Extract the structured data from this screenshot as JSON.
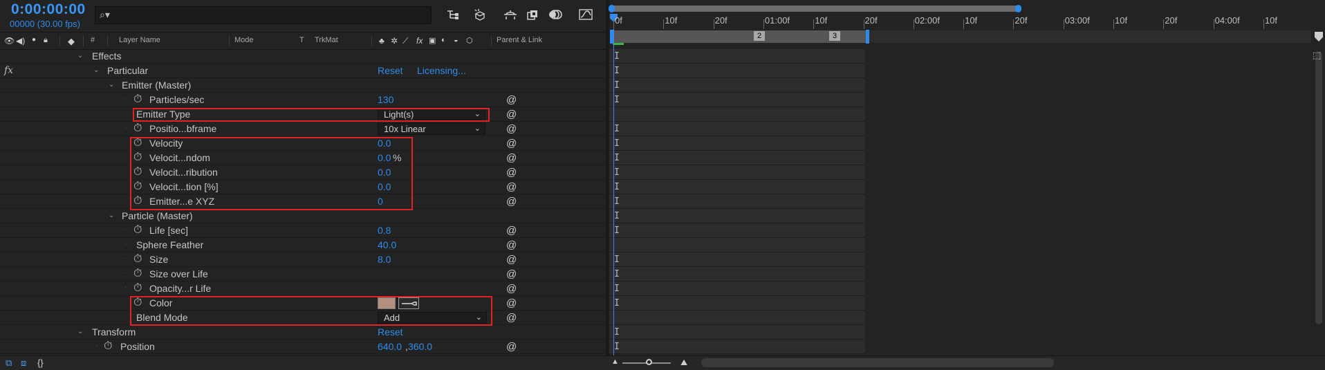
{
  "header": {
    "timecode": "0:00:00:00",
    "fps_line": "00000 (30.00 fps)",
    "search_icon": "search-icon"
  },
  "columns": {
    "label": "#",
    "layer_name": "Layer Name",
    "mode": "Mode",
    "t": "T",
    "trkmat": "TrkMat",
    "parent_link": "Parent & Link"
  },
  "rows": {
    "effects": "Effects",
    "fx": "fx",
    "particular": "Particular",
    "reset": "Reset",
    "licensing": "Licensing...",
    "emitter_master": "Emitter (Master)",
    "particles_sec": {
      "label": "Particles/sec",
      "value": "130"
    },
    "emitter_type": {
      "label": "Emitter Type",
      "value": "Light(s)"
    },
    "position_subframe": {
      "label": "Positio...bframe",
      "value": "10x Linear"
    },
    "velocity": {
      "label": "Velocity",
      "value": "0.0"
    },
    "velocity_random": {
      "label": "Velocit...ndom",
      "value": "0.0",
      "unit": "%"
    },
    "velocity_distribution": {
      "label": "Velocit...ribution",
      "value": "0.0"
    },
    "velocity_motion": {
      "label": "Velocit...tion [%]",
      "value": "0.0"
    },
    "emitter_size": {
      "label": "Emitter...e XYZ",
      "value": "0"
    },
    "particle_master": "Particle (Master)",
    "life": {
      "label": "Life [sec]",
      "value": "0.8"
    },
    "sphere_feather": {
      "label": "Sphere Feather",
      "value": "40.0"
    },
    "size": {
      "label": "Size",
      "value": "8.0"
    },
    "size_over_life": {
      "label": "Size over Life"
    },
    "opacity_over_life": {
      "label": "Opacity...r Life"
    },
    "color": {
      "label": "Color",
      "swatch": "#b48f7d"
    },
    "blend_mode": {
      "label": "Blend Mode",
      "value": "Add"
    },
    "transform": "Transform",
    "transform_reset": "Reset",
    "position": {
      "label": "Position",
      "value_x": "640.0",
      "sep": ",",
      "value_y": "360.0"
    }
  },
  "timeline": {
    "ruler_labels": [
      "0f",
      "10f",
      "20f",
      "01:00f",
      "10f",
      "20f",
      "02:00f",
      "10f",
      "20f",
      "03:00f",
      "10f",
      "20f",
      "04:00f",
      "10f"
    ],
    "markers": [
      "2",
      "3"
    ],
    "playhead_color": "#3a8be9"
  },
  "colors": {
    "accent": "#2d8ceb",
    "highlight_box": "#e02424",
    "background": "#232323"
  }
}
